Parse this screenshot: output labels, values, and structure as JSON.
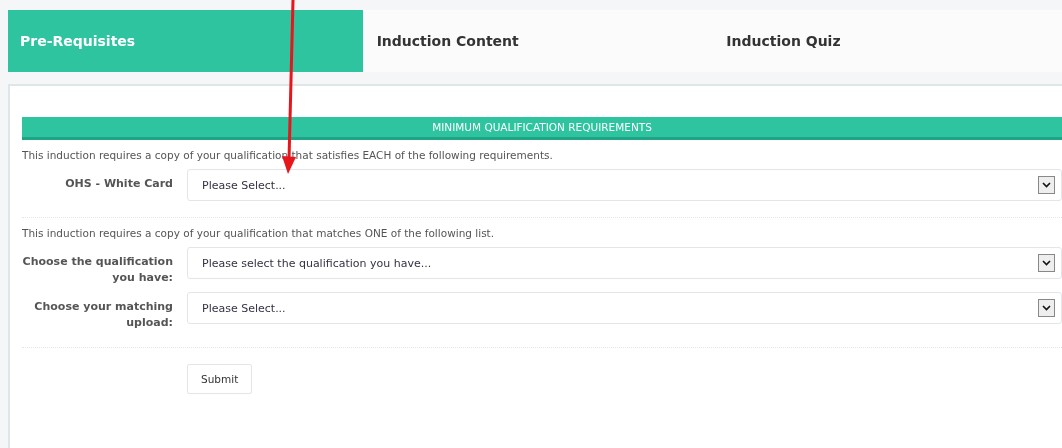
{
  "tabs": [
    {
      "label": "Pre-Requisites",
      "selected": true
    },
    {
      "label": "Induction Content",
      "selected": false
    },
    {
      "label": "Induction Quiz",
      "selected": false
    }
  ],
  "section_title": "MINIMUM QUALIFICATION REQUIREMENTS",
  "groups": [
    {
      "intro": "This induction requires a copy of your qualification that satisfies EACH of the following requirements.",
      "fields": [
        {
          "label": "OHS - White Card",
          "value": "Please Select..."
        }
      ]
    },
    {
      "intro": "This induction requires a copy of your qualification that matches ONE of the following list.",
      "fields": [
        {
          "label": "Choose the qualification you have:",
          "value": "Please select the qualification you have..."
        },
        {
          "label": "Choose your matching upload:",
          "value": "Please Select..."
        }
      ]
    }
  ],
  "submit": "Submit"
}
